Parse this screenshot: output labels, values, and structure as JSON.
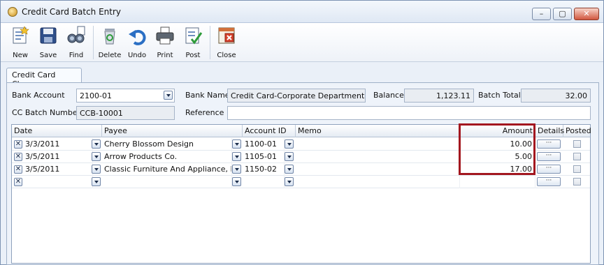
{
  "window": {
    "title": "Credit Card Batch Entry",
    "min_label": "–",
    "max_label": "▢",
    "close_label": "✕"
  },
  "toolbar": {
    "new": "New",
    "save": "Save",
    "find": "Find",
    "delete": "Delete",
    "undo": "Undo",
    "print": "Print",
    "post": "Post",
    "close": "Close"
  },
  "tab": {
    "label": "Credit Card Charges"
  },
  "form": {
    "bank_account_label": "Bank Account",
    "bank_account_value": "2100-01",
    "bank_name_label": "Bank Name",
    "bank_name_value": "Credit Card-Corporate Department",
    "balance_label": "Balance",
    "balance_value": "1,123.11",
    "batch_total_label": "Batch Total",
    "batch_total_value": "32.00",
    "cc_batch_label": "CC Batch Number",
    "cc_batch_value": "CCB-10001",
    "reference_label": "Reference",
    "reference_value": ""
  },
  "grid": {
    "headers": {
      "date": "Date",
      "payee": "Payee",
      "account": "Account ID",
      "memo": "Memo",
      "amount": "Amount",
      "details": "Details",
      "posted": "Posted"
    },
    "rows": [
      {
        "date": "3/3/2011",
        "payee": "Cherry Blossom Design",
        "account": "1100-01",
        "memo": "",
        "amount": "10.00",
        "details": "···"
      },
      {
        "date": "3/5/2011",
        "payee": "Arrow Products Co.",
        "account": "1105-01",
        "memo": "",
        "amount": "5.00",
        "details": "···"
      },
      {
        "date": "3/5/2011",
        "payee": "Classic Furniture And Appliance, Inc.",
        "account": "1150-02",
        "memo": "",
        "amount": "17.00",
        "details": "···"
      },
      {
        "date": "",
        "payee": "",
        "account": "",
        "memo": "",
        "amount": "",
        "details": "···"
      }
    ],
    "delete_glyph": "✕"
  },
  "colors": {
    "highlight": "#a3171f",
    "window_bg": "#eaf0f8"
  }
}
